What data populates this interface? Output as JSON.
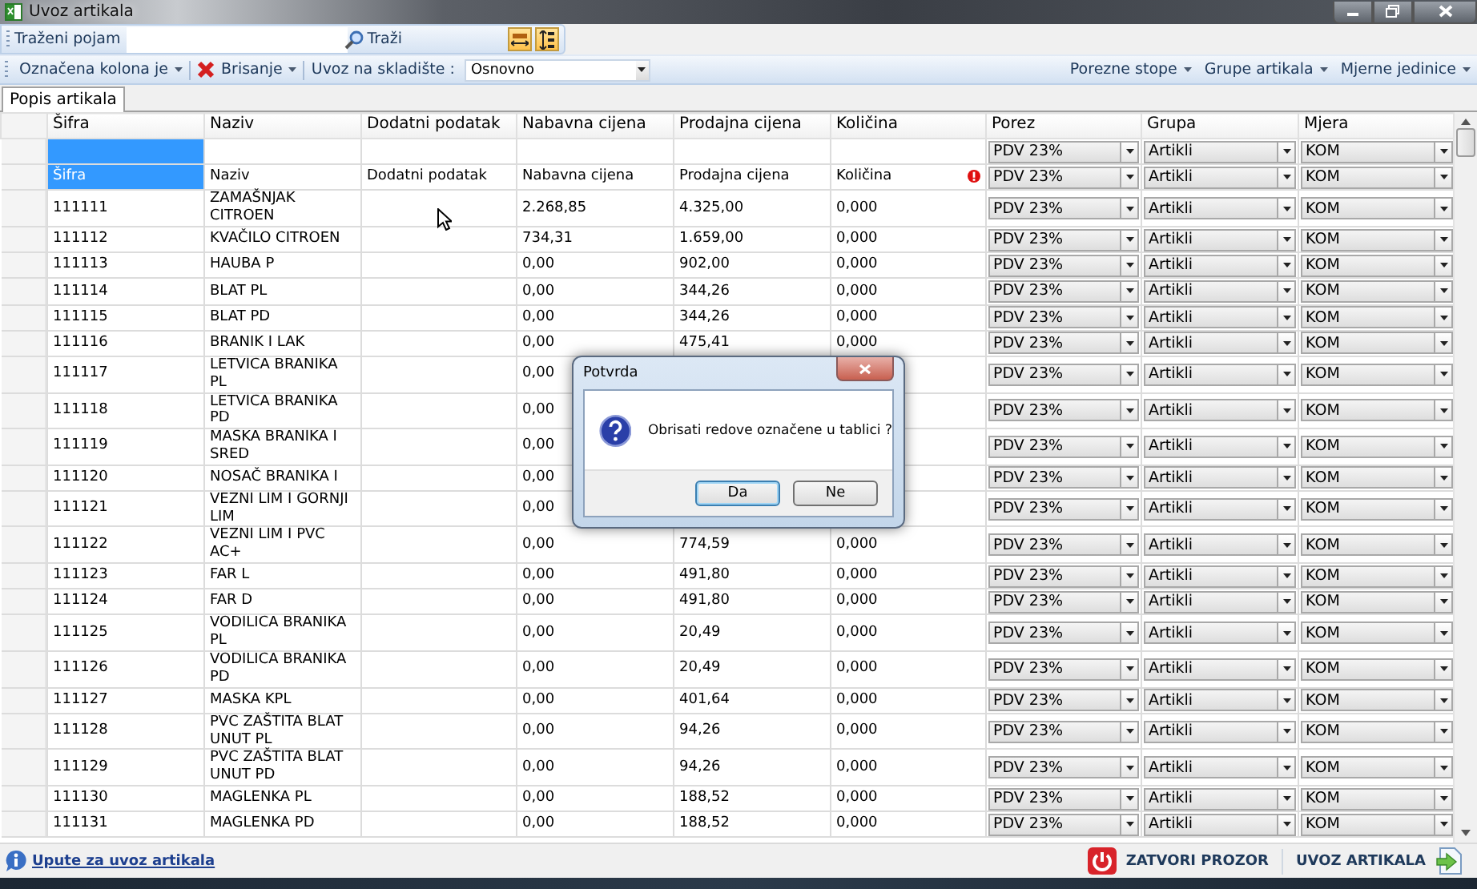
{
  "window": {
    "title": "Uvoz artikala"
  },
  "search_bar": {
    "label": "Traženi pojam",
    "search_button": "Traži"
  },
  "toolbar": {
    "left_items": [
      {
        "kind": "menu",
        "label": "Označena kolona je"
      },
      {
        "kind": "delete",
        "label": "Brisanje"
      },
      {
        "kind": "label",
        "label": "Uvoz na skladište :"
      },
      {
        "kind": "combo",
        "label": "Osnovno"
      }
    ],
    "right_items": [
      {
        "kind": "menu",
        "label": "Porezne stope"
      },
      {
        "kind": "menu",
        "label": "Grupe artikala"
      },
      {
        "kind": "menu",
        "label": "Mjerne jedinice"
      }
    ]
  },
  "tabs": [
    {
      "label": "Popis artikala",
      "selected": true
    }
  ],
  "table": {
    "columns": [
      "Šifra",
      "Naziv",
      "Dodatni podatak",
      "Nabavna cijena",
      "Prodajna cijena",
      "Količina",
      "Porez",
      "Grupa",
      "Mjera"
    ],
    "filter_row": {
      "sifra_selected": true,
      "porez": "PDV 23%",
      "grupa": "Artikli",
      "mjera": "KOM"
    },
    "entry_row": {
      "sifra_selected": true,
      "error": true,
      "cells": [
        "Šifra",
        "Naziv",
        "Dodatni podatak",
        "Nabavna cijena",
        "Prodajna cijena",
        "Količina"
      ],
      "porez": "PDV 23%",
      "grupa": "Artikli",
      "mjera": "KOM"
    },
    "rows": [
      {
        "sifra": "111111",
        "naziv": "ZAMAŠNJAK CITROEN",
        "nabavna": "2.268,85",
        "prodajna": "4.325,00",
        "kolicina": "0,000",
        "porez": "PDV 23%",
        "grupa": "Artikli",
        "mjera": "KOM"
      },
      {
        "sifra": "111112",
        "naziv": "KVAČILO CITROEN",
        "nabavna": "734,31",
        "prodajna": "1.659,00",
        "kolicina": "0,000",
        "porez": "PDV 23%",
        "grupa": "Artikli",
        "mjera": "KOM"
      },
      {
        "sifra": "111113",
        "naziv": "HAUBA P",
        "nabavna": "0,00",
        "prodajna": "902,00",
        "kolicina": "0,000",
        "porez": "PDV 23%",
        "grupa": "Artikli",
        "mjera": "KOM"
      },
      {
        "sifra": "111114",
        "naziv": "BLAT PL",
        "nabavna": "0,00",
        "prodajna": "344,26",
        "kolicina": "0,000",
        "porez": "PDV 23%",
        "grupa": "Artikli",
        "mjera": "KOM"
      },
      {
        "sifra": "111115",
        "naziv": "BLAT PD",
        "nabavna": "0,00",
        "prodajna": "344,26",
        "kolicina": "0,000",
        "porez": "PDV 23%",
        "grupa": "Artikli",
        "mjera": "KOM"
      },
      {
        "sifra": "111116",
        "naziv": "BRANIK I LAK",
        "nabavna": "0,00",
        "prodajna": "475,41",
        "kolicina": "0,000",
        "porez": "PDV 23%",
        "grupa": "Artikli",
        "mjera": "KOM"
      },
      {
        "sifra": "111117",
        "naziv": "LETVICA BRANIKA PL",
        "nabavna": "0,00",
        "porez": "PDV 23%",
        "grupa": "Artikli",
        "mjera": "KOM"
      },
      {
        "sifra": "111118",
        "naziv": "LETVICA BRANIKA PD",
        "nabavna": "0,00",
        "porez": "PDV 23%",
        "grupa": "Artikli",
        "mjera": "KOM"
      },
      {
        "sifra": "111119",
        "naziv": "MASKA BRANIKA I SRED",
        "nabavna": "0,00",
        "porez": "PDV 23%",
        "grupa": "Artikli",
        "mjera": "KOM"
      },
      {
        "sifra": "111120",
        "naziv": "NOSAČ BRANIKA I",
        "nabavna": "0,00",
        "porez": "PDV 23%",
        "grupa": "Artikli",
        "mjera": "KOM"
      },
      {
        "sifra": "111121",
        "naziv": "VEZNI LIM I GORNJI LIM",
        "nabavna": "0,00",
        "porez": "PDV 23%",
        "grupa": "Artikli",
        "mjera": "KOM"
      },
      {
        "sifra": "111122",
        "naziv": "VEZNI LIM I PVC AC+",
        "nabavna": "0,00",
        "prodajna": "774,59",
        "kolicina": "0,000",
        "porez": "PDV 23%",
        "grupa": "Artikli",
        "mjera": "KOM"
      },
      {
        "sifra": "111123",
        "naziv": "FAR L",
        "nabavna": "0,00",
        "prodajna": "491,80",
        "kolicina": "0,000",
        "porez": "PDV 23%",
        "grupa": "Artikli",
        "mjera": "KOM"
      },
      {
        "sifra": "111124",
        "naziv": "FAR D",
        "nabavna": "0,00",
        "prodajna": "491,80",
        "kolicina": "0,000",
        "porez": "PDV 23%",
        "grupa": "Artikli",
        "mjera": "KOM"
      },
      {
        "sifra": "111125",
        "naziv": "VODILICA BRANIKA PL",
        "nabavna": "0,00",
        "prodajna": "20,49",
        "kolicina": "0,000",
        "porez": "PDV 23%",
        "grupa": "Artikli",
        "mjera": "KOM"
      },
      {
        "sifra": "111126",
        "naziv": "VODILICA BRANIKA PD",
        "nabavna": "0,00",
        "prodajna": "20,49",
        "kolicina": "0,000",
        "porez": "PDV 23%",
        "grupa": "Artikli",
        "mjera": "KOM"
      },
      {
        "sifra": "111127",
        "naziv": "MASKA KPL",
        "nabavna": "0,00",
        "prodajna": "401,64",
        "kolicina": "0,000",
        "porez": "PDV 23%",
        "grupa": "Artikli",
        "mjera": "KOM"
      },
      {
        "sifra": "111128",
        "naziv": "PVC ZAŠTITA BLAT UNUT PL",
        "nabavna": "0,00",
        "prodajna": "94,26",
        "kolicina": "0,000",
        "porez": "PDV 23%",
        "grupa": "Artikli",
        "mjera": "KOM"
      },
      {
        "sifra": "111129",
        "naziv": "PVC ZAŠTITA BLAT UNUT PD",
        "nabavna": "0,00",
        "prodajna": "94,26",
        "kolicina": "0,000",
        "porez": "PDV 23%",
        "grupa": "Artikli",
        "mjera": "KOM"
      },
      {
        "sifra": "111130",
        "naziv": "MAGLENKA PL",
        "nabavna": "0,00",
        "prodajna": "188,52",
        "kolicina": "0,000",
        "porez": "PDV 23%",
        "grupa": "Artikli",
        "mjera": "KOM"
      },
      {
        "sifra": "111131",
        "naziv": "MAGLENKA PD",
        "nabavna": "0,00",
        "prodajna": "188,52",
        "kolicina": "0,000",
        "porez": "PDV 23%",
        "grupa": "Artikli",
        "mjera": "KOM"
      }
    ]
  },
  "dialog": {
    "title": "Potvrda",
    "message": "Obrisati redove označene u tablici ?",
    "buttons": [
      {
        "label": "Da",
        "focused": true
      },
      {
        "label": "Ne",
        "focused": false
      }
    ]
  },
  "footer": {
    "help_link": "Upute za uvoz artikala",
    "buttons": [
      {
        "kind": "close",
        "label": "ZATVORI PROZOR"
      },
      {
        "kind": "import",
        "label": "UVOZ ARTIKALA"
      }
    ]
  }
}
